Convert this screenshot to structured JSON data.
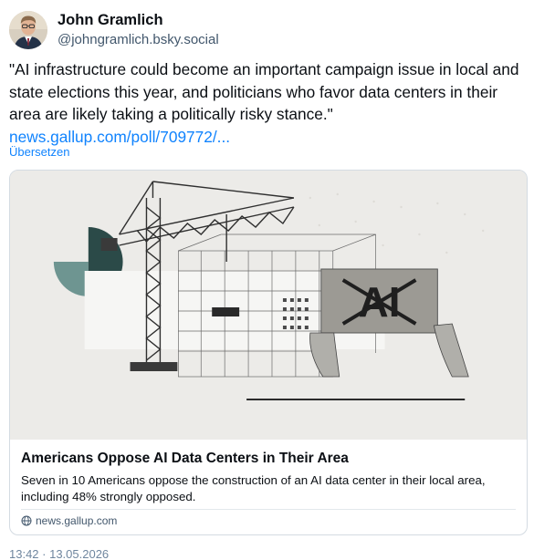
{
  "author": {
    "display_name": "John Gramlich",
    "handle": "@johngramlich.bsky.social"
  },
  "post": {
    "text": "\"AI infrastructure could become an important campaign issue in local and state elections this year, and politicians who favor data centers in their area are likely taking a politically risky stance.\"",
    "link_text": "news.gallup.com/poll/709772/...",
    "translate_label": "Übersetzen",
    "timestamp": "13:42 · 13.05.2026"
  },
  "card": {
    "title": "Americans Oppose AI Data Centers in Their Area",
    "description": "Seven in 10 Americans oppose the construction of an AI data center in their local area, including 48% strongly opposed.",
    "domain": "news.gallup.com",
    "image_sign_text": "AI"
  },
  "icons": {
    "domain_icon": "globe-icon"
  },
  "colors": {
    "link": "#1083fe",
    "secondary_text": "#42576c",
    "border": "#d4dbe2"
  }
}
